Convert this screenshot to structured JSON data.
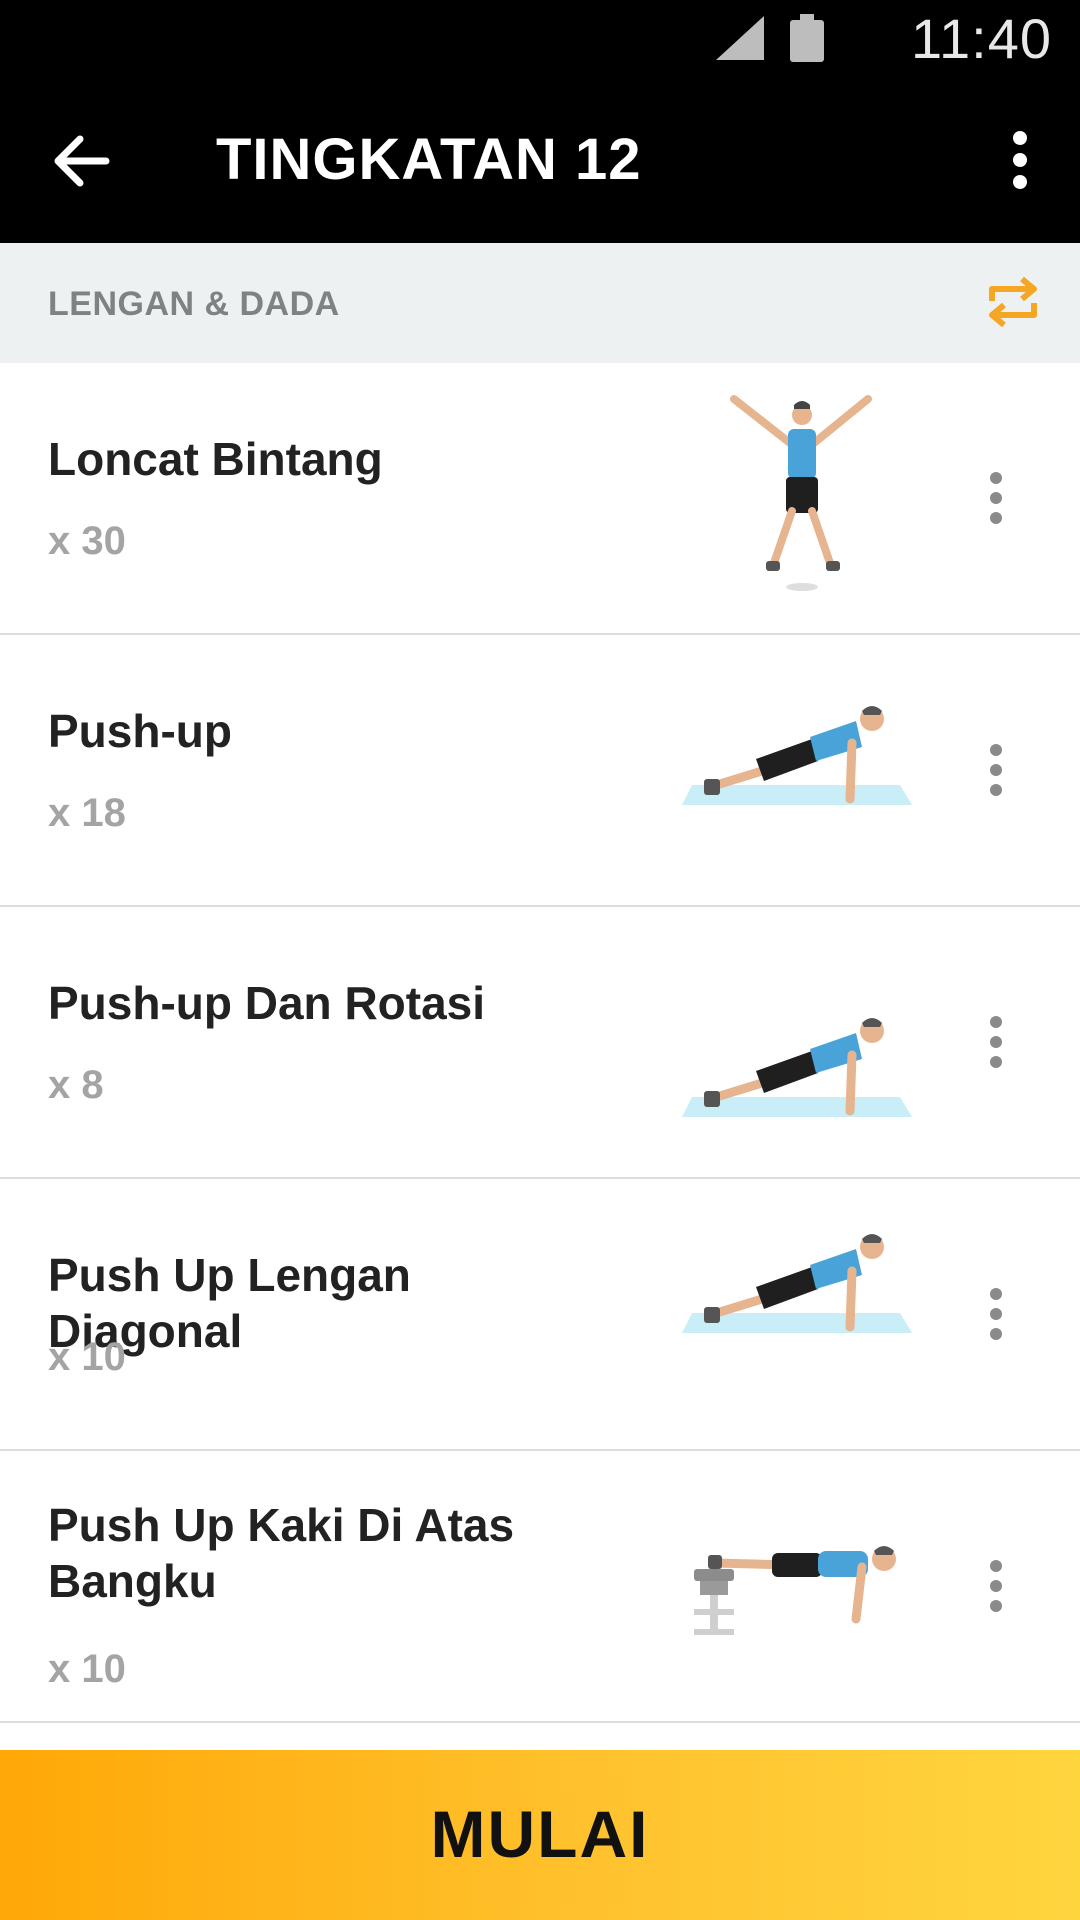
{
  "status": {
    "time": "11:40"
  },
  "appbar": {
    "title": "TINGKATAN 12"
  },
  "section": {
    "title": "LENGAN & DADA",
    "accent_color": "#f5a623"
  },
  "exercises": [
    {
      "name": "Loncat Bintang",
      "reps": "x 30",
      "illustration": "jumping-jack"
    },
    {
      "name": "Push-up",
      "reps": "x 18",
      "illustration": "push-up"
    },
    {
      "name": "Push-up Dan Rotasi",
      "reps": "x 8",
      "illustration": "push-up"
    },
    {
      "name": "Push Up Lengan Diagonal",
      "reps": "x 10",
      "illustration": "push-up"
    },
    {
      "name": "Push Up Kaki Di Atas Bangku",
      "reps": "x 10",
      "illustration": "decline-push-up"
    }
  ],
  "footer": {
    "start_label": "MULAI"
  }
}
